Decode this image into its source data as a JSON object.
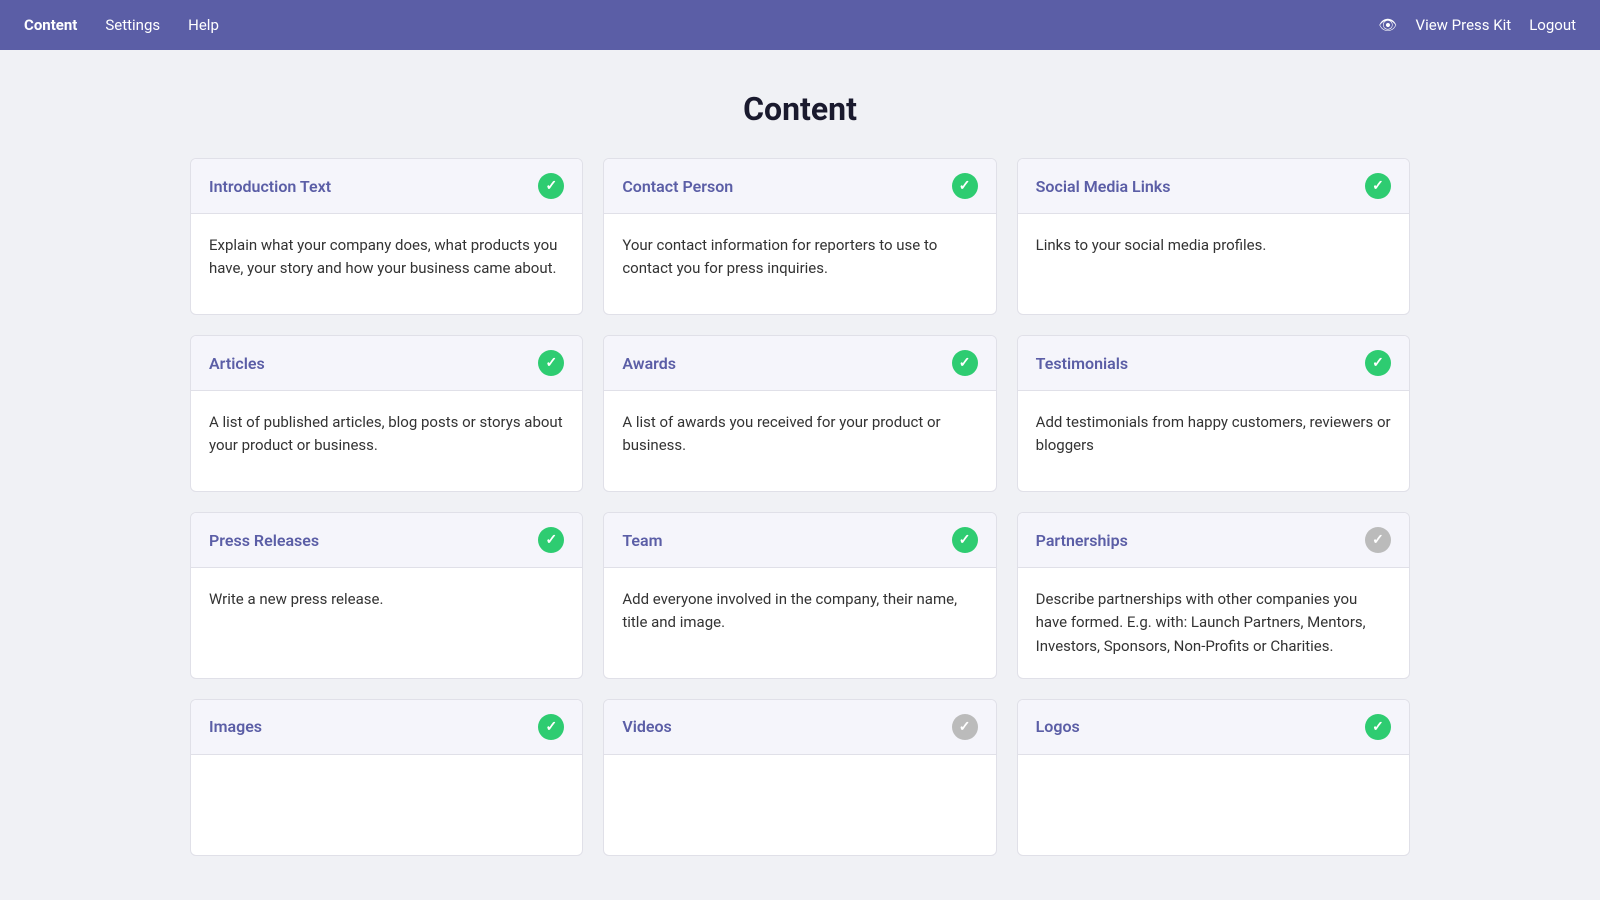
{
  "nav": {
    "items": [
      {
        "label": "Content",
        "active": true
      },
      {
        "label": "Settings",
        "active": false
      },
      {
        "label": "Help",
        "active": false
      }
    ],
    "view_press_kit": "View Press Kit",
    "logout": "Logout"
  },
  "page": {
    "title": "Content"
  },
  "cards": [
    {
      "id": "introduction-text",
      "title": "Introduction Text",
      "status": "green",
      "body": "Explain what your company does, what products you have, your story and how your business came about."
    },
    {
      "id": "contact-person",
      "title": "Contact Person",
      "status": "green",
      "body": "Your contact information for reporters to use to contact you for press inquiries."
    },
    {
      "id": "social-media-links",
      "title": "Social Media Links",
      "status": "green",
      "body": "Links to your social media profiles."
    },
    {
      "id": "articles",
      "title": "Articles",
      "status": "green",
      "body": "A list of published articles, blog posts or storys about your product or business."
    },
    {
      "id": "awards",
      "title": "Awards",
      "status": "green",
      "body": "A list of awards you received for your product or business."
    },
    {
      "id": "testimonials",
      "title": "Testimonials",
      "status": "green",
      "body": "Add testimonials from happy customers, reviewers or bloggers"
    },
    {
      "id": "press-releases",
      "title": "Press Releases",
      "status": "green",
      "body": "Write a new press release."
    },
    {
      "id": "team",
      "title": "Team",
      "status": "green",
      "body": "Add everyone involved in the company, their name, title and image."
    },
    {
      "id": "partnerships",
      "title": "Partnerships",
      "status": "gray",
      "body": "Describe partnerships with other companies you have formed. E.g. with: Launch Partners, Mentors, Investors, Sponsors, Non-Profits or Charities."
    },
    {
      "id": "images",
      "title": "Images",
      "status": "green",
      "body": ""
    },
    {
      "id": "videos",
      "title": "Videos",
      "status": "gray",
      "body": ""
    },
    {
      "id": "logos",
      "title": "Logos",
      "status": "green",
      "body": ""
    }
  ]
}
